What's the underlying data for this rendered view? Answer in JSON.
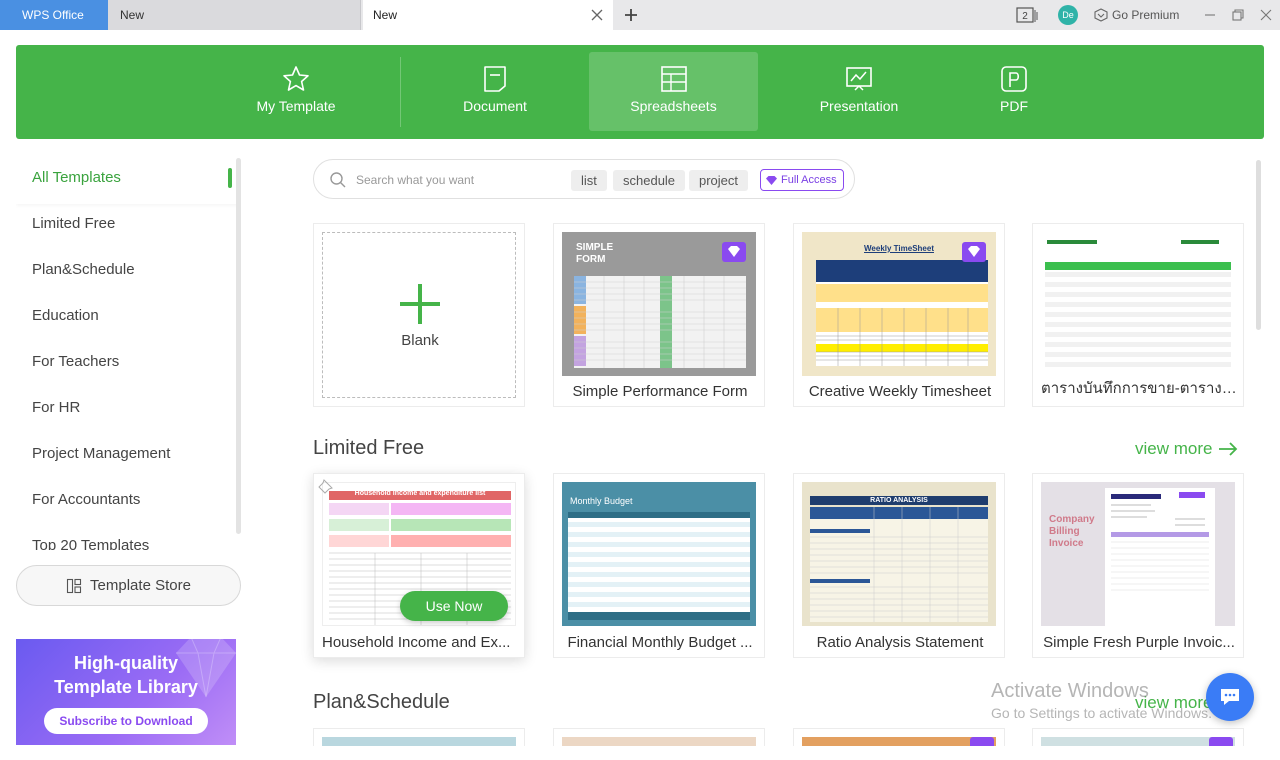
{
  "titlebar": {
    "home_tab": "WPS Office",
    "tabs": [
      "New",
      "New"
    ],
    "window_count": "2",
    "avatar_initials": "De",
    "premium_label": "Go Premium"
  },
  "categories": [
    {
      "label": "My Template",
      "icon": "star-icon"
    },
    {
      "label": "Document",
      "icon": "document-icon"
    },
    {
      "label": "Spreadsheets",
      "icon": "spreadsheet-icon"
    },
    {
      "label": "Presentation",
      "icon": "presentation-icon"
    },
    {
      "label": "PDF",
      "icon": "pdf-icon"
    }
  ],
  "active_category": "Spreadsheets",
  "sidebar": {
    "items": [
      {
        "label": "All Templates"
      },
      {
        "label": "Limited Free"
      },
      {
        "label": "Plan&Schedule"
      },
      {
        "label": "Education"
      },
      {
        "label": "For Teachers"
      },
      {
        "label": "For HR"
      },
      {
        "label": "Project Management"
      },
      {
        "label": "For Accountants"
      },
      {
        "label": "Top 20 Templates"
      }
    ],
    "store_button": "Template Store",
    "promo": {
      "line1": "High-quality",
      "line2": "Template Library",
      "button": "Subscribe to Download"
    }
  },
  "search": {
    "placeholder": "Search what you want",
    "chips": [
      "list",
      "schedule",
      "project"
    ],
    "full_access": "Full Access"
  },
  "row1": {
    "blank_label": "Blank",
    "cards": [
      {
        "label": "Simple Performance Form",
        "thumb_title": "SIMPLE\nFORM"
      },
      {
        "label": "Creative Weekly Timesheet",
        "thumb_title": "Weekly TimeSheet"
      },
      {
        "label": "ตารางบันทึกการขาย-ตารางบัน..."
      }
    ]
  },
  "sections": {
    "limited_free": {
      "title": "Limited Free",
      "view_more": "view more"
    },
    "plan_schedule": {
      "title": "Plan&Schedule",
      "view_more": "view more"
    }
  },
  "row2": {
    "use_now": "Use Now",
    "cards": [
      {
        "label": "Household Income and Ex...",
        "thumb_title": "Household income and expenditure list"
      },
      {
        "label": "Financial Monthly Budget ...",
        "thumb_title": "Monthly Budget"
      },
      {
        "label": "Ratio Analysis Statement",
        "thumb_title": "RATIO ANALYSIS"
      },
      {
        "label": "Simple Fresh Purple Invoic...",
        "thumb_title": "Company Billing Invoice"
      }
    ]
  },
  "watermark": {
    "line1": "Activate Windows",
    "line2": "Go to Settings to activate Windows."
  },
  "colors": {
    "brand_green": "#45b449",
    "premium_purple": "#8a4af0",
    "home_tab_blue": "#4a90e2"
  }
}
